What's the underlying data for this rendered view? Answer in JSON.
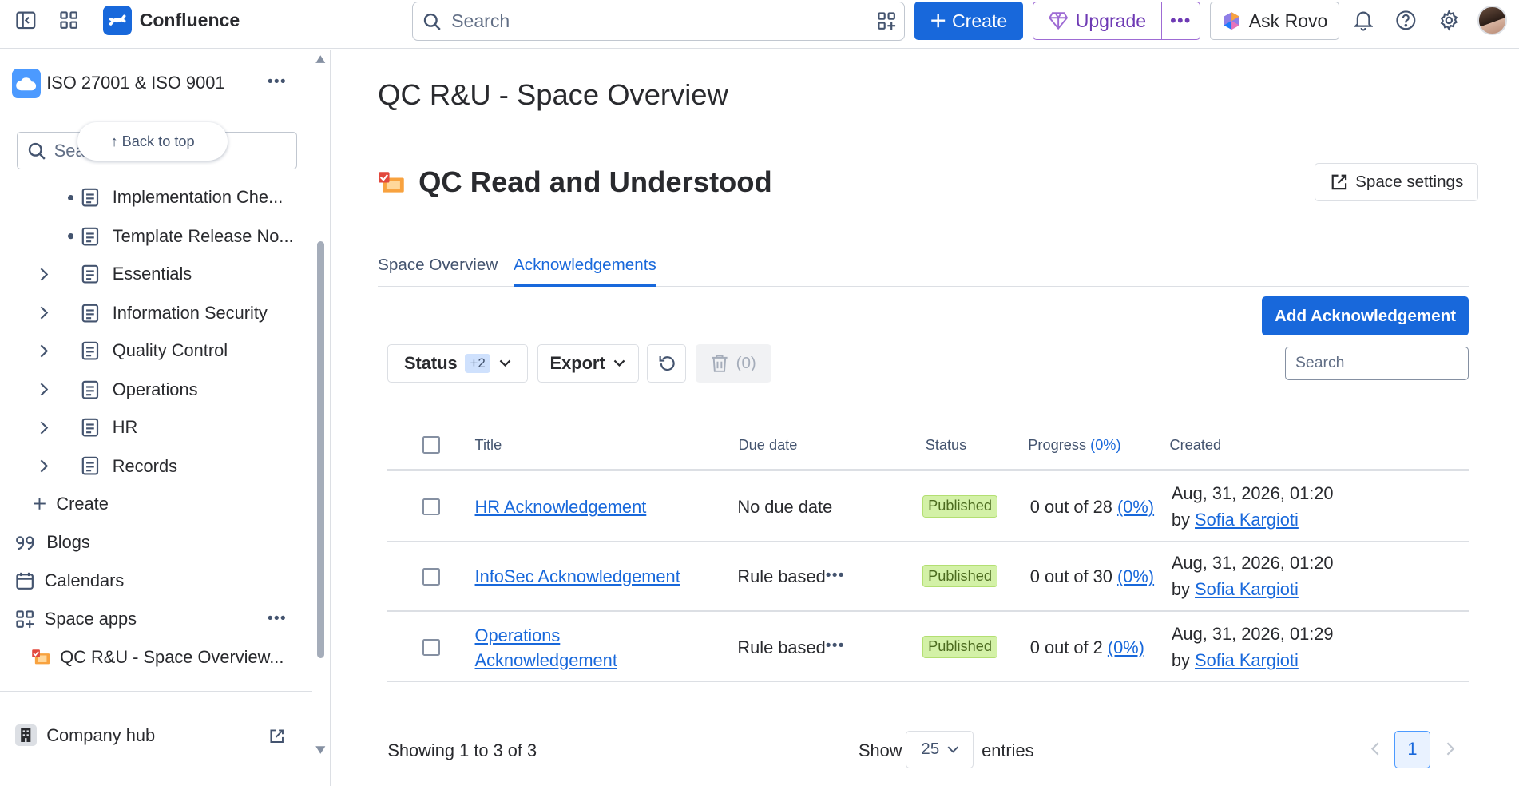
{
  "app": {
    "name": "Confluence"
  },
  "topbar": {
    "search_placeholder": "Search",
    "create_label": "Create",
    "upgrade_label": "Upgrade",
    "more_label": "•••",
    "rovo_label": "Ask Rovo"
  },
  "sidebar": {
    "space_name": "ISO 27001 & ISO 9001",
    "space_more": "•••",
    "search_placeholder": "Sea",
    "back_to_top": "↑ Back to top",
    "tree": [
      {
        "label": "Implementation Che...",
        "kind": "bullet"
      },
      {
        "label": "Template Release No...",
        "kind": "bullet"
      },
      {
        "label": "Essentials",
        "kind": "chevron"
      },
      {
        "label": "Information Security",
        "kind": "chevron"
      },
      {
        "label": "Quality Control",
        "kind": "chevron"
      },
      {
        "label": "Operations",
        "kind": "chevron"
      },
      {
        "label": "HR",
        "kind": "chevron"
      },
      {
        "label": "Records",
        "kind": "chevron"
      }
    ],
    "create_label": "Create",
    "blogs_label": "Blogs",
    "calendars_label": "Calendars",
    "space_apps_label": "Space apps",
    "space_apps_more": "•••",
    "app_item_label": "QC R&U - Space Overview...",
    "company_hub_label": "Company hub"
  },
  "main": {
    "page_title": "QC R&U - Space Overview",
    "heading": "QC Read and Understood",
    "space_settings_label": "Space settings",
    "tabs": [
      {
        "label": "Space Overview"
      },
      {
        "label": "Acknowledgements"
      }
    ],
    "add_button": "Add Acknowledgement",
    "filters": {
      "status_label": "Status",
      "status_badge": "+2",
      "export_label": "Export",
      "delete_count": "(0)"
    },
    "table_search_placeholder": "Search",
    "table": {
      "headers": {
        "title": "Title",
        "due": "Due date",
        "status": "Status",
        "progress": "Progress",
        "progress_pct": "(0%)",
        "created": "Created"
      },
      "rows": [
        {
          "title": "HR Acknowledgement",
          "due": "No due date",
          "has_more": false,
          "status": "Published",
          "progress": "0 out of 28",
          "pct": "(0%)",
          "created": "Aug, 31, 2026, 01:20",
          "by": "by",
          "author": "Sofia Kargioti"
        },
        {
          "title": "InfoSec Acknowledgement",
          "due": "Rule based",
          "has_more": true,
          "status": "Published",
          "progress": "0 out of 30",
          "pct": "(0%)",
          "created": "Aug, 31, 2026, 01:20",
          "by": "by",
          "author": "Sofia Kargioti"
        },
        {
          "title_line1": "Operations",
          "title_line2": "Acknowledgement",
          "due": "Rule based",
          "has_more": true,
          "status": "Published",
          "progress": "0 out of 2",
          "pct": "(0%)",
          "created": "Aug, 31, 2026, 01:29",
          "by": "by",
          "author": "Sofia Kargioti"
        }
      ],
      "row_more": "•••"
    },
    "footer": {
      "showing": "Showing 1 to 3 of 3",
      "show": "Show",
      "page_size": "25",
      "entries": "entries",
      "current_page": "1"
    }
  }
}
